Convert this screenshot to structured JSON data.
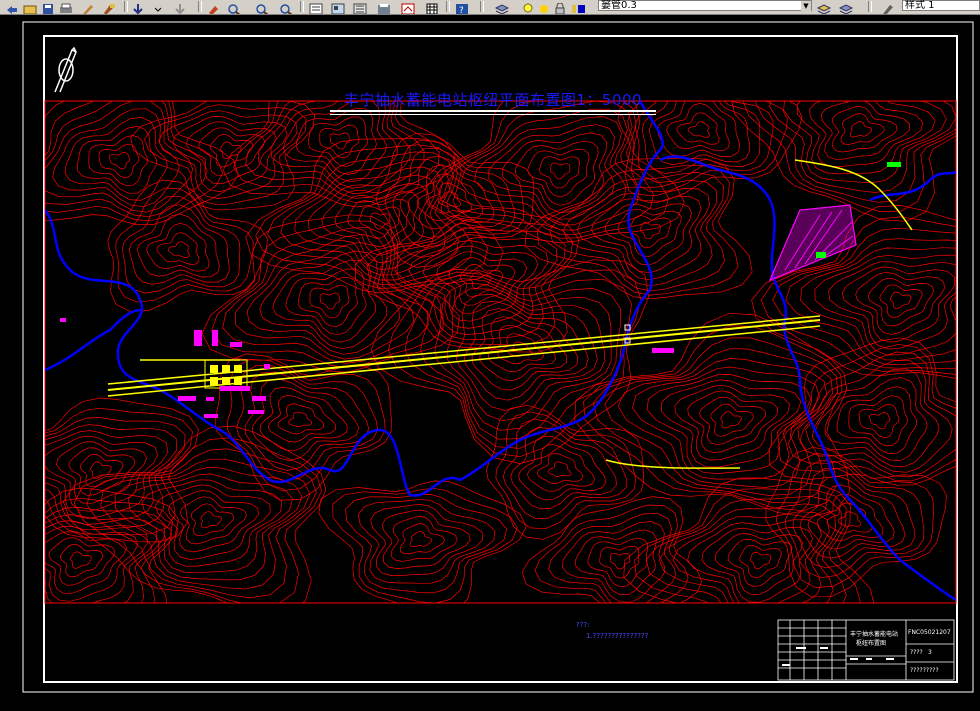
{
  "toolbar": {
    "layer_value": "窭管0.3",
    "style_value": "样式 1",
    "icons": [
      "undo-icon",
      "open-icon",
      "save-icon",
      "print-icon",
      "match-properties-icon",
      "arrow-down-icon",
      "pan-icon",
      "zoom-realtime-icon",
      "zoom-window-icon",
      "zoom-previous-icon",
      "properties-icon",
      "design-center-icon",
      "tool-palettes-icon",
      "sheet-set-icon",
      "markup-icon",
      "quickcalc-icon",
      "help-icon",
      "layer-manager-icon",
      "light-bulb-icon",
      "sun-icon",
      "lock-icon",
      "color-icon",
      "layer-state-icon",
      "layer-previous-icon",
      "text-style-icon"
    ]
  },
  "drawing": {
    "title": "丰宁抽水蓄能电站枢纽平面布置图1：5000",
    "notes": [
      "???:",
      "1.???????????????"
    ],
    "title_block": {
      "project_name": "丰宁抽水蓄能电站",
      "drawing_name": "枢纽布置图",
      "drawing_number": "FNC05021207",
      "scale_label": "????",
      "sheet": "3",
      "date": "?????????"
    }
  },
  "colors": {
    "background": "#000000",
    "contours": "#ff0000",
    "rivers": "#0000ff",
    "tunnels": "#ffff00",
    "labels_magenta": "#ff00ff",
    "labels_green": "#00ff00",
    "title": "#1a1aff"
  }
}
